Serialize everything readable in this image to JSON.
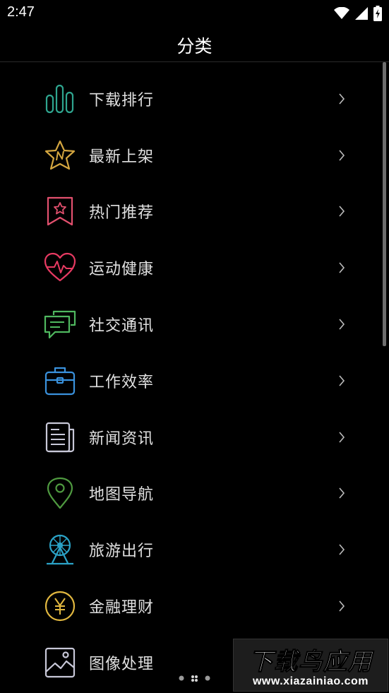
{
  "status_bar": {
    "time": "2:47",
    "icons": [
      "wifi-icon",
      "cellular-signal-icon",
      "battery-charging-icon"
    ]
  },
  "header": {
    "title": "分类"
  },
  "categories": [
    {
      "label": "下载排行",
      "icon": "bar-chart-icon",
      "color": "#2fa58f"
    },
    {
      "label": "最新上架",
      "icon": "new-star-icon",
      "color": "#d4a640"
    },
    {
      "label": "热门推荐",
      "icon": "bookmark-star-icon",
      "color": "#e2506e"
    },
    {
      "label": "运动健康",
      "icon": "heart-pulse-icon",
      "color": "#e73a62"
    },
    {
      "label": "社交通讯",
      "icon": "chat-bubbles-icon",
      "color": "#4fb85f"
    },
    {
      "label": "工作效率",
      "icon": "briefcase-icon",
      "color": "#3a92dd"
    },
    {
      "label": "新闻资讯",
      "icon": "newspaper-icon",
      "color": "#c8c8d8"
    },
    {
      "label": "地图导航",
      "icon": "map-pin-icon",
      "color": "#4f9a40"
    },
    {
      "label": "旅游出行",
      "icon": "ferris-wheel-icon",
      "color": "#2ba3c7"
    },
    {
      "label": "金融理财",
      "icon": "yen-coin-icon",
      "color": "#e2b840"
    },
    {
      "label": "图像处理",
      "icon": "image-icon",
      "color": "#c8c8d8"
    }
  ],
  "watermark": {
    "text": "下载鸟应用",
    "url": "www.xiazainiao.com"
  }
}
